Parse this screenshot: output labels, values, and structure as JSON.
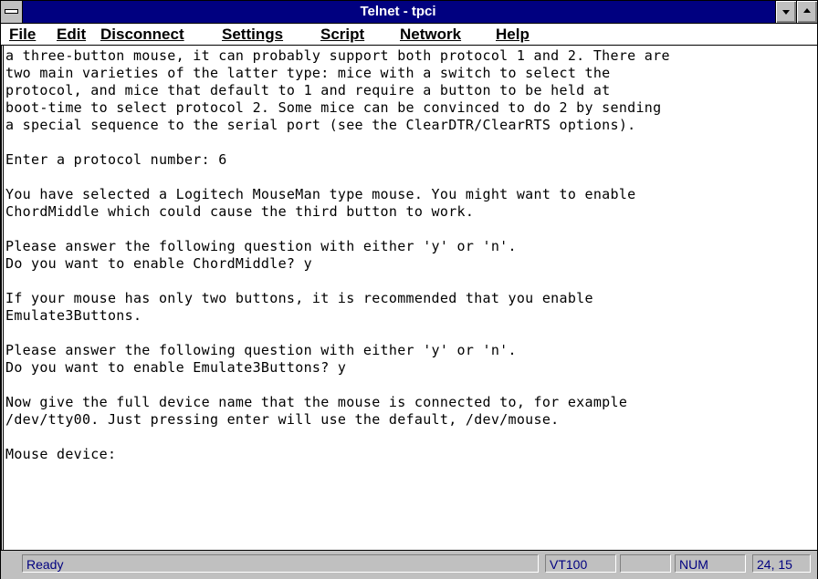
{
  "window": {
    "title": "Telnet - tpci"
  },
  "menu": {
    "items": [
      {
        "label": "File"
      },
      {
        "label": "Edit"
      },
      {
        "label": "Disconnect"
      },
      {
        "label": "Settings"
      },
      {
        "label": "Script"
      },
      {
        "label": "Network"
      },
      {
        "label": "Help"
      }
    ]
  },
  "terminal": {
    "lines": [
      "a three-button mouse, it can probably support both protocol 1 and 2. There are",
      "two main varieties of the latter type: mice with a switch to select the",
      "protocol, and mice that default to 1 and require a button to be held at",
      "boot-time to select protocol 2. Some mice can be convinced to do 2 by sending",
      "a special sequence to the serial port (see the ClearDTR/ClearRTS options).",
      "",
      "Enter a protocol number: 6",
      "",
      "You have selected a Logitech MouseMan type mouse. You might want to enable",
      "ChordMiddle which could cause the third button to work.",
      "",
      "Please answer the following question with either 'y' or 'n'.",
      "Do you want to enable ChordMiddle? y",
      "",
      "If your mouse has only two buttons, it is recommended that you enable",
      "Emulate3Buttons.",
      "",
      "Please answer the following question with either 'y' or 'n'.",
      "Do you want to enable Emulate3Buttons? y",
      "",
      "Now give the full device name that the mouse is connected to, for example",
      "/dev/tty00. Just pressing enter will use the default, /dev/mouse.",
      "",
      "Mouse device:"
    ]
  },
  "status": {
    "state": "Ready",
    "emulation": "VT100",
    "blank": "",
    "num": "NUM",
    "position": "24, 15"
  }
}
